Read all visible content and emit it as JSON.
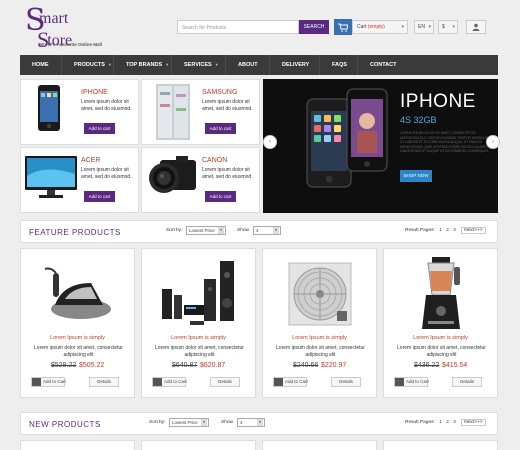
{
  "header": {
    "logo_line1": "mart",
    "logo_line2": "tore",
    "logo_big": "S",
    "tagline": "World's Favourite Online Mall",
    "search_placeholder": "Search for Products",
    "search_button": "SEARCH",
    "cart_label": "Cart",
    "cart_status": "(empty)",
    "language": "EN",
    "currency": "$"
  },
  "nav": {
    "items": [
      "HOME",
      "PRODUCTS",
      "TOP BRANDS",
      "SERVICES",
      "ABOUT",
      "DELIVERY",
      "FAQS",
      "CONTACT"
    ],
    "has_dropdown": [
      false,
      true,
      true,
      true,
      false,
      false,
      false,
      false
    ]
  },
  "promo": [
    {
      "title": "IPHONE",
      "desc": "Lorem ipsum dolor sit amet, sed do eiusmod.",
      "button": "Add to cart"
    },
    {
      "title": "SAMSUNG",
      "desc": "Lorem ipsum dolor sit amet, sed do eiusmod.",
      "button": "Add to cart"
    },
    {
      "title": "ACER",
      "desc": "Lorem ipsum dolor sit amet, sed do eiusmod.",
      "button": "Add to cart"
    },
    {
      "title": "CANON",
      "desc": "Lorem ipsum dolor sit amet, sed do eiusmod.",
      "button": "Add to cart"
    }
  ],
  "banner": {
    "title": "IPHONE",
    "subtitle": "4S 32GB",
    "desc": "LOREM IPSUM DOLOR SIT AMET, CONSECTETUR ADIPISICING ELIT, SED DO EIUSMOD TEMPOR INCIDIDUNT UT LABORE ET DOLORE MAGNA ALIQUA. UT ENIM AD MINIM VENIAM, QUIS NOSTRUD EXERCITATION ULLAMCO LABORIS NISI UT ALIQUIP EX EA COMMODO CONSEQUAT.",
    "button": "SHOP NOW",
    "prev": "‹",
    "next": "›"
  },
  "featured": {
    "title": "FEATURE PRODUCTS",
    "sort_label": "Sort by:",
    "sort_value": "Lowest Price",
    "show_label": "Show",
    "show_value": "4",
    "result_label": "Result Pages:",
    "pages": [
      "1",
      "2",
      "3"
    ],
    "next": "Next>>>"
  },
  "products": [
    {
      "name": "Lorem Ipsum is simply",
      "desc": "Lorem ipsum dolor sit amet, consectetur adipiscing elit",
      "old": "$528.22",
      "price": "$505.22",
      "add": "Add to Cart",
      "details": "Details"
    },
    {
      "name": "Lorem Ipsum is simply",
      "desc": "Lorem ipsum dolor sit amet, consectetur adipiscing elit",
      "old": "$640.87",
      "price": "$620.87",
      "add": "Add to Cart",
      "details": "Details"
    },
    {
      "name": "Lorem Ipsum is simply",
      "desc": "Lorem ipsum dolor sit amet, consectetur adipiscing elit",
      "old": "$240.66",
      "price": "$220.97",
      "add": "Add to Cart",
      "details": "Details"
    },
    {
      "name": "Lorem Ipsum is simply",
      "desc": "Lorem ipsum dolor sit amet, consectetur adipiscing elit",
      "old": "$436.22",
      "price": "$415.54",
      "add": "Add to Cart",
      "details": "Details"
    }
  ],
  "new_products": {
    "title": "NEW PRODUCTS",
    "sort_label": "Sort by:",
    "sort_value": "Lowest Price",
    "show_label": "Show",
    "show_value": "4",
    "result_label": "Result Pages:",
    "pages": [
      "1",
      "2",
      "3"
    ],
    "next": "Next>>>"
  },
  "colors": {
    "brand": "#5a2a82",
    "accent_red": "#c0392b",
    "nav_bg": "#3a3a3a",
    "banner_blue": "#2a86c8"
  }
}
